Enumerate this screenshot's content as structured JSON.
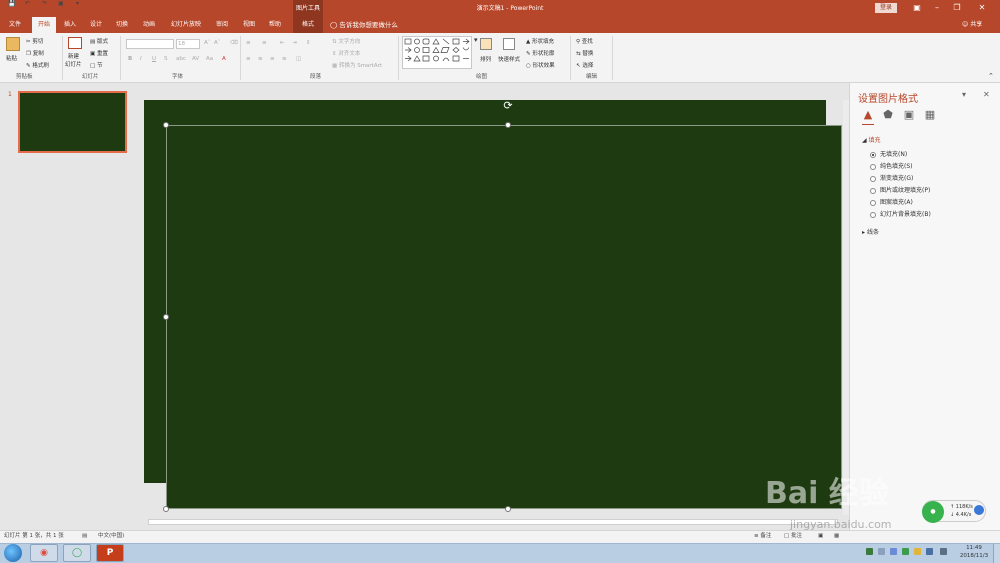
{
  "title_bar": {
    "quick_access": [
      "save-icon",
      "undo-icon",
      "redo-icon",
      "start-from-beginning-icon",
      "customize-icon"
    ],
    "context_tab": "图片工具",
    "doc_title": "演示文稿1  -  PowerPoint",
    "login": "登录",
    "window_buttons": [
      "ribbon-display-icon",
      "minimize-icon",
      "restore-icon",
      "close-icon"
    ]
  },
  "tabs": [
    "文件",
    "开始",
    "插入",
    "设计",
    "切换",
    "动画",
    "幻灯片放映",
    "审阅",
    "视图",
    "帮助",
    "格式"
  ],
  "active_tab": "开始",
  "tell_me": "告诉我你想要做什么",
  "share": "共享",
  "ribbon": {
    "clipboard": {
      "paste": "粘贴",
      "cut": "剪切",
      "copy": "复制",
      "format_painter": "格式刷",
      "label": "剪贴板"
    },
    "slides": {
      "new_slide": "新建",
      "new_slide2": "幻灯片",
      "layout": "版式",
      "reset": "重置",
      "section": "节",
      "label": "幻灯片"
    },
    "font": {
      "font_size": "18",
      "label": "字体",
      "bold": "B",
      "italic": "I",
      "underline": "U",
      "shadow": "S"
    },
    "paragraph": {
      "text_direction": "文字方向",
      "align_text": "对齐文本",
      "smartart": "转换为 SmartArt",
      "label": "段落"
    },
    "drawing": {
      "arrange": "排列",
      "quick_styles": "快速样式",
      "shape_fill": "形状填充",
      "shape_outline": "形状轮廓",
      "shape_effects": "形状效果",
      "label": "绘图"
    },
    "editing": {
      "find": "查找",
      "replace": "替换",
      "select": "选择",
      "label": "编辑"
    }
  },
  "thumbnails": [
    {
      "number": "1"
    }
  ],
  "format_pane": {
    "title": "设置图片格式",
    "section_fill": "填充",
    "fill_options": [
      "无填充(N)",
      "纯色填充(S)",
      "渐变填充(G)",
      "图片或纹理填充(P)",
      "图案填充(A)",
      "幻灯片背景填充(B)"
    ],
    "selected_option": "无填充(N)",
    "section_line": "线条"
  },
  "status_bar": {
    "slide_info": "幻灯片 第 1 张，共 1 张",
    "language": "中文(中国)",
    "notes": "备注",
    "comments": "批注"
  },
  "net_widget": {
    "up": "118K/s",
    "down": "4.4K/s"
  },
  "taskbar": {
    "time": "11:49",
    "date": "2018/11/3"
  },
  "watermark": {
    "text": "Bai 经验",
    "url": "jingyan.baidu.com"
  },
  "colors": {
    "accent": "#b7472a",
    "slide_bg": "#1d3a10"
  }
}
